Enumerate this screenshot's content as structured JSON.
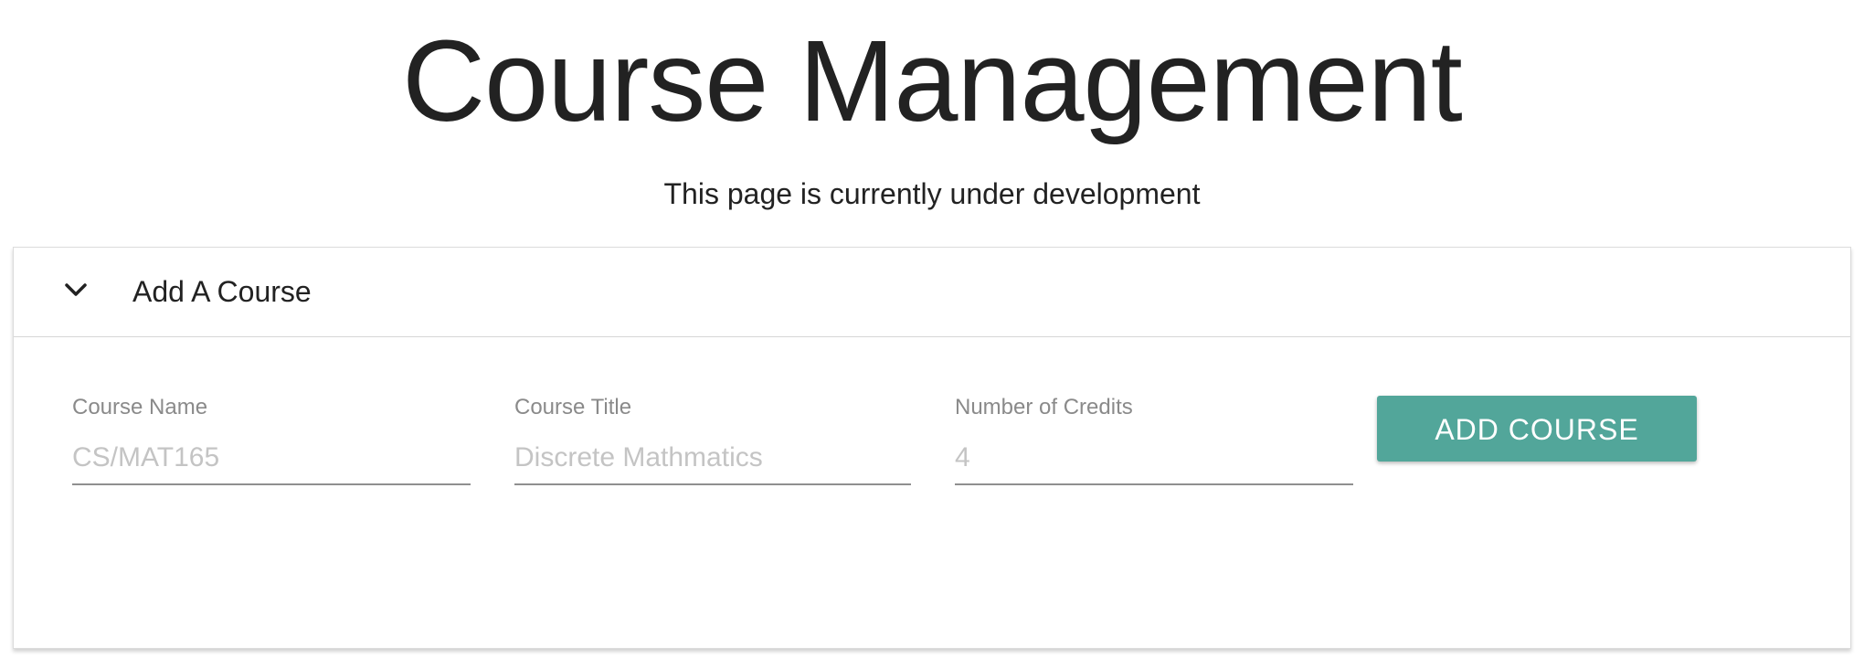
{
  "page": {
    "title": "Course Management",
    "subtitle": "This page is currently under development"
  },
  "panel": {
    "header_label": "Add A Course",
    "expand_icon": "chevron-down-icon",
    "fields": [
      {
        "label": "Course Name",
        "placeholder": "CS/MAT165",
        "value": ""
      },
      {
        "label": "Course Title",
        "placeholder": "Discrete Mathmatics",
        "value": ""
      },
      {
        "label": "Number of Credits",
        "placeholder": "4",
        "value": ""
      }
    ],
    "submit_label": "ADD COURSE"
  },
  "colors": {
    "button_bg": "#52a69a",
    "button_text": "#ffffff",
    "title_text": "#222222",
    "label_text": "#8a8a8a",
    "placeholder_text": "#c4c4c4",
    "underline": "#8f8f8f"
  }
}
